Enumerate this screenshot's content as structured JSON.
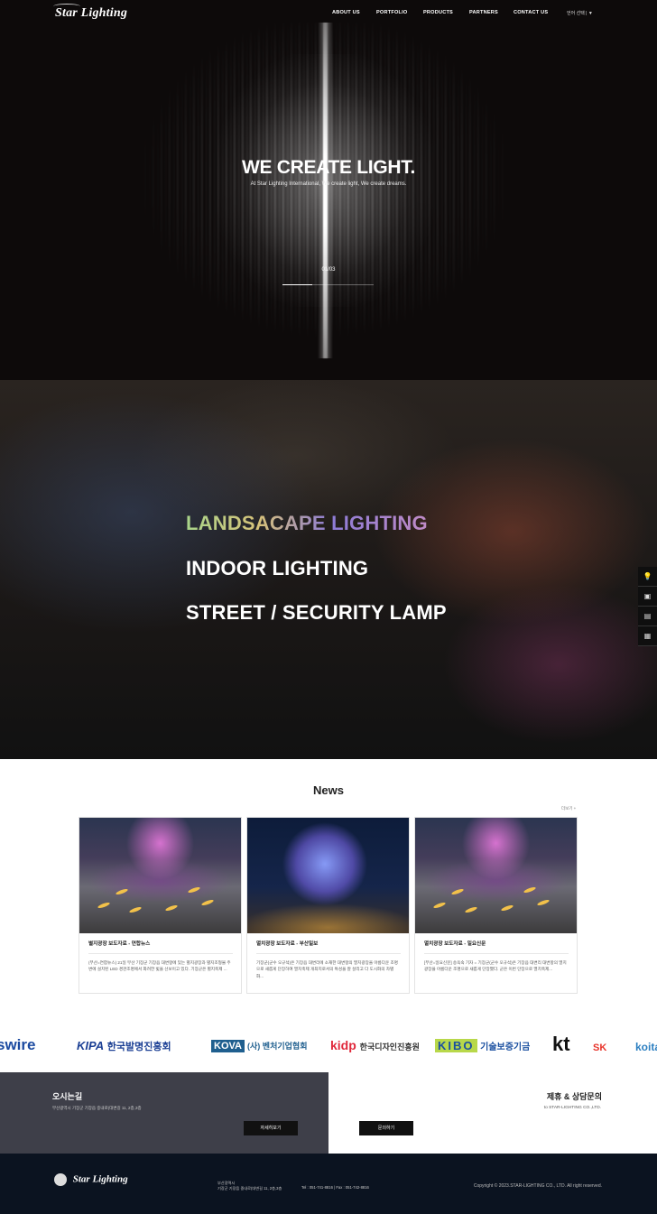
{
  "header": {
    "logo": "Star Lighting",
    "nav": [
      {
        "label": "ABOUT US"
      },
      {
        "label": "PORTFOLIO"
      },
      {
        "label": "PRODUCTS"
      },
      {
        "label": "PARTNERS"
      },
      {
        "label": "CONTACT US"
      }
    ],
    "lang": "언어 선택 | ▼"
  },
  "hero": {
    "title": "WE CREATE LIGHT.",
    "subtitle": "At Star Lighting International, We create light, We create dreams.",
    "counter": "01/03",
    "progress": 0.33
  },
  "categories": [
    "LANDSACAPE LIGHTING",
    "INDOOR LIGHTING",
    "STREET / SECURITY LAMP"
  ],
  "quick_menu": [
    {
      "icon": "lightbulb-icon",
      "glyph": "💡"
    },
    {
      "icon": "catalog-icon",
      "glyph": "▣"
    },
    {
      "icon": "document-icon",
      "glyph": "▤"
    },
    {
      "icon": "qr-code-icon",
      "glyph": "▦"
    }
  ],
  "news": {
    "title": "News",
    "more": "더보기 +",
    "items": [
      {
        "title": "별지광장 보도자료 - 연합뉴스",
        "body": "(부산=연합뉴스) 21일 부산 기장군 기장읍 대변항에 있는 별지광장과 별지조형물 주변에 설치된 LED 경관조명에서 화려한 빛을 선보이고 있다. 기장군은 별지축제 ..."
      },
      {
        "title": "멸치광장 보도자료 - 부산일보",
        "body": "기장군(군수 오규석)은 기장읍 대변리에 소재한 대변항의 멸치광장을 아름다운 조명으로 새롭게 단장하여 멸치축제 개최지로서의 특성을 잘 살리고 다 도시화의 차별화..."
      },
      {
        "title": "멸치광장 보도자료 - 일요신문",
        "body": "[부산=일요신문] 송옥숙 기자 = 기장군(군수 오규석)은 기장읍 대변리 대변항의 멸치광장을 아름다운 조명으로 새롭게 단장했다. 군은 이번 단장으로 멸치축제..."
      }
    ]
  },
  "partners": [
    {
      "text": "swire",
      "color": "#1b4aa0"
    },
    {
      "text": "KIPA",
      "sub": "한국발명진흥회",
      "color": "#1b3f94"
    },
    {
      "text": "KOVA",
      "sub": "(사) 벤처기업협회",
      "color": "#1f5f8f"
    },
    {
      "text": "kidp",
      "sub": "한국디자인진흥원",
      "color": "#e0283b"
    },
    {
      "text": "KIBO",
      "sub": "기술보증기금",
      "color": "#1a4fa0"
    },
    {
      "text": "kt",
      "color": "#111111"
    },
    {
      "text": "SK",
      "color": "#e8352b"
    },
    {
      "text": "koita",
      "color": "#2c7fc1"
    }
  ],
  "location": {
    "title": "오시는길",
    "address": "부산광역시 기장군 기장읍 중내로(대변길 11, 2층,3층",
    "button": "자세히보기"
  },
  "contact": {
    "title": "제휴 & 상담문의",
    "to": "to STAR-LIGHTING CO.,LTD.",
    "button": "문의하기"
  },
  "footer": {
    "logo": "Star Lighting",
    "city": "부산광역시",
    "address": "기장군 기장읍 중내로(대변길 11, 2층,3층",
    "tel": "Tel : 051-741-8816  |  Fax : 051-742-8816",
    "copyright": "Copyright © 2023.STAR-LIGHTING CO., LTD. All right reserved."
  }
}
